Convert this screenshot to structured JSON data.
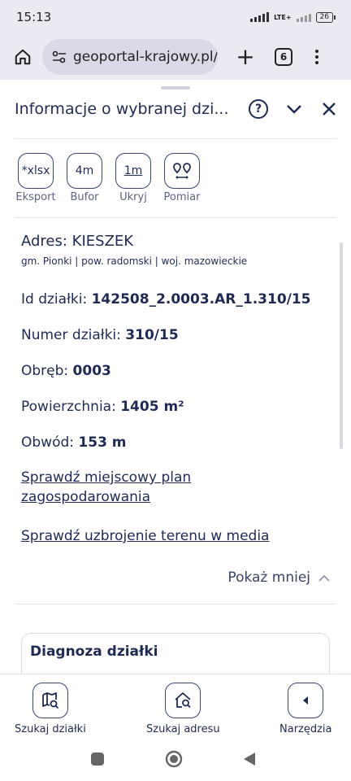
{
  "status": {
    "time": "15:13",
    "network": "LTE+",
    "battery": "26"
  },
  "browser": {
    "url": "geoportal-krajowy.pl/i",
    "tab_count": "6"
  },
  "panel": {
    "title": "Informacje o wybranej dzi..."
  },
  "tools": [
    {
      "icon_text": "*xlsx",
      "label": "Eksport"
    },
    {
      "icon_text": "4m",
      "label": "Bufor"
    },
    {
      "icon_text": "1m",
      "label": "Ukryj"
    },
    {
      "icon_text": "",
      "label": "Pomiar"
    }
  ],
  "parcel": {
    "address": "Adres: KIESZEK",
    "location": "gm. Pionki | pow. radomski | woj. mazowieckie",
    "id_label": "Id działki: ",
    "id_value": "142508_2.0003.AR_1.310/15",
    "number_label": "Numer działki: ",
    "number_value": "310/15",
    "precinct_label": "Obręb: ",
    "precinct_value": "0003",
    "area_label": "Powierzchnia: ",
    "area_value": "1405 m²",
    "perimeter_label": "Obwód: ",
    "perimeter_value": "153 m"
  },
  "links": {
    "plan_line1": "Sprawdź miejscowy plan",
    "plan_line2": "zagospodarowania",
    "media": "Sprawdź uzbrojenie terenu w media"
  },
  "show_less": "Pokaż mniej",
  "diagnosis_card": {
    "title": "Diagnoza działki"
  },
  "bottom_nav": [
    {
      "label": "Szukaj działki",
      "icon": "map-search-icon"
    },
    {
      "label": "Szukaj adresu",
      "icon": "home-search-icon"
    },
    {
      "label": "Narzędzia",
      "icon": "chevron-left-icon"
    }
  ]
}
